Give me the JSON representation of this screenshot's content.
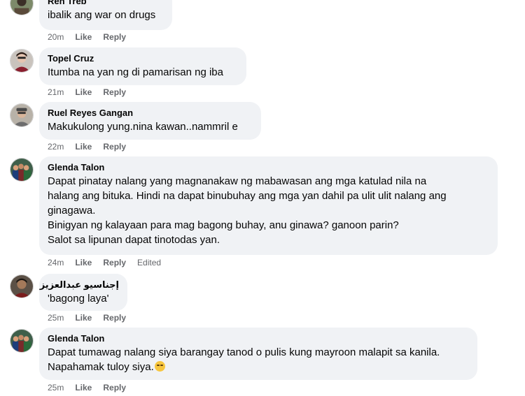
{
  "comments": [
    {
      "author": "Ren Treb",
      "lines": [
        "ibalik ang war on drugs"
      ],
      "time": "20m",
      "like_label": "Like",
      "reply_label": "Reply",
      "edited": ""
    },
    {
      "author": "Topel Cruz",
      "lines": [
        "Itumba na yan ng di pamarisan ng iba"
      ],
      "time": "21m",
      "like_label": "Like",
      "reply_label": "Reply",
      "edited": ""
    },
    {
      "author": "Ruel Reyes Gangan",
      "lines": [
        "Makukulong yung.nina kawan..nammril e"
      ],
      "time": "22m",
      "like_label": "Like",
      "reply_label": "Reply",
      "edited": ""
    },
    {
      "author": "Glenda Talon",
      "lines": [
        "Dapat pinatay nalang yang magnanakaw ng mabawasan ang mga katulad nila na",
        "halang ang bituka. Hindi na dapat binubuhay ang mga yan dahil pa ulit ulit nalang ang",
        "ginagawa.",
        "Binigyan ng kalayaan para mag bagong buhay, anu ginawa? ganoon parin?",
        "Salot sa lipunan dapat tinotodas yan."
      ],
      "time": "24m",
      "like_label": "Like",
      "reply_label": "Reply",
      "edited": "Edited"
    },
    {
      "author": "إجناسيو عبدالعزيز",
      "lines": [
        "'bagong laya'"
      ],
      "time": "25m",
      "like_label": "Like",
      "reply_label": "Reply",
      "edited": ""
    },
    {
      "author": "Glenda Talon",
      "lines": [
        "Dapat tumawag nalang siya barangay tanod o pulis kung mayroon malapit sa kanila.",
        "Napahamak tuloy siya."
      ],
      "time": "25m",
      "like_label": "Like",
      "reply_label": "Reply",
      "edited": ""
    }
  ],
  "colors": {
    "bubble": "#f0f2f5",
    "meta": "#65676b",
    "text": "#050505"
  },
  "icons": {
    "emoji": "pensive-face-icon",
    "avatar": "profile-photo"
  }
}
